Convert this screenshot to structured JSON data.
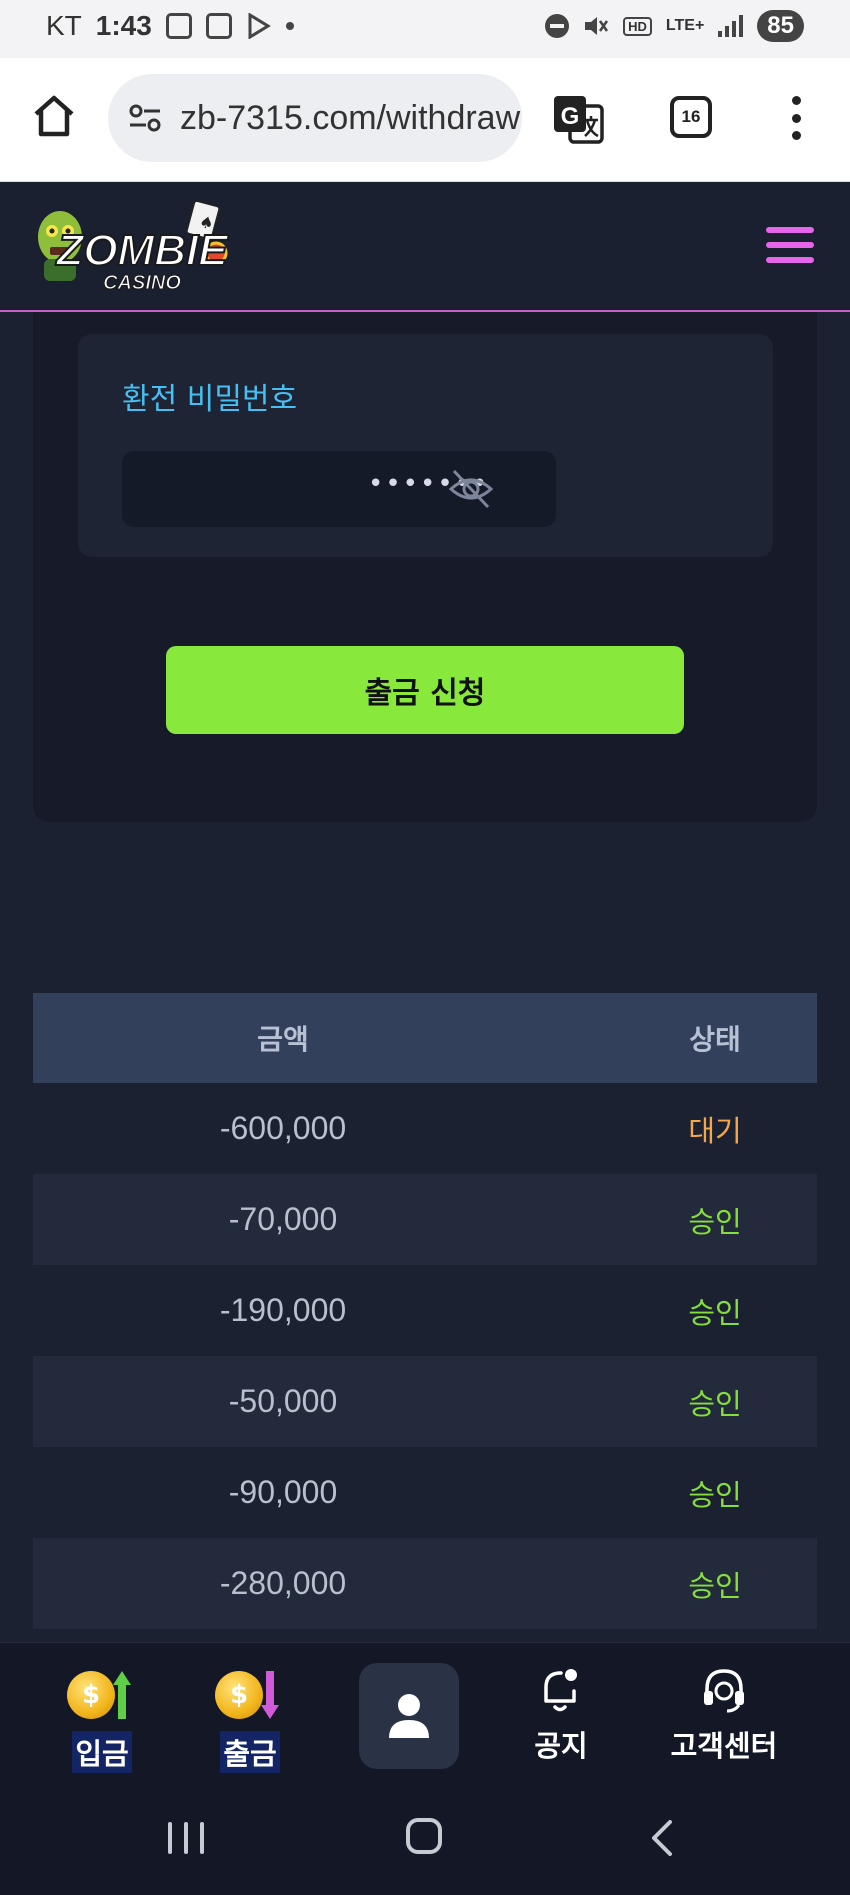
{
  "status_bar": {
    "carrier": "KT",
    "time": "1:43",
    "network": "LTE+",
    "battery": "85",
    "hd_label": "HD"
  },
  "browser": {
    "url": "zb-7315.com/withdraw",
    "tab_count": "16"
  },
  "site": {
    "logo_text": "ZOMBIE",
    "logo_subtext": "CASINO",
    "accent_color": "#e665ea"
  },
  "form": {
    "password_label": "환전 비밀번호",
    "password_value": "•••••••",
    "submit_label": "출금 신청"
  },
  "history": {
    "headers": {
      "amount": "금액",
      "status": "상태"
    },
    "rows": [
      {
        "amount": "-600,000",
        "status": "대기",
        "status_color": "#f3a74a"
      },
      {
        "amount": "-70,000",
        "status": "승인",
        "status_color": "#84df3c"
      },
      {
        "amount": "-190,000",
        "status": "승인",
        "status_color": "#84df3c"
      },
      {
        "amount": "-50,000",
        "status": "승인",
        "status_color": "#84df3c"
      },
      {
        "amount": "-90,000",
        "status": "승인",
        "status_color": "#84df3c"
      },
      {
        "amount": "-280,000",
        "status": "승인",
        "status_color": "#84df3c"
      }
    ]
  },
  "bottom_nav": {
    "deposit": "입금",
    "withdraw": "출금",
    "notice": "공지",
    "support": "고객센터"
  }
}
